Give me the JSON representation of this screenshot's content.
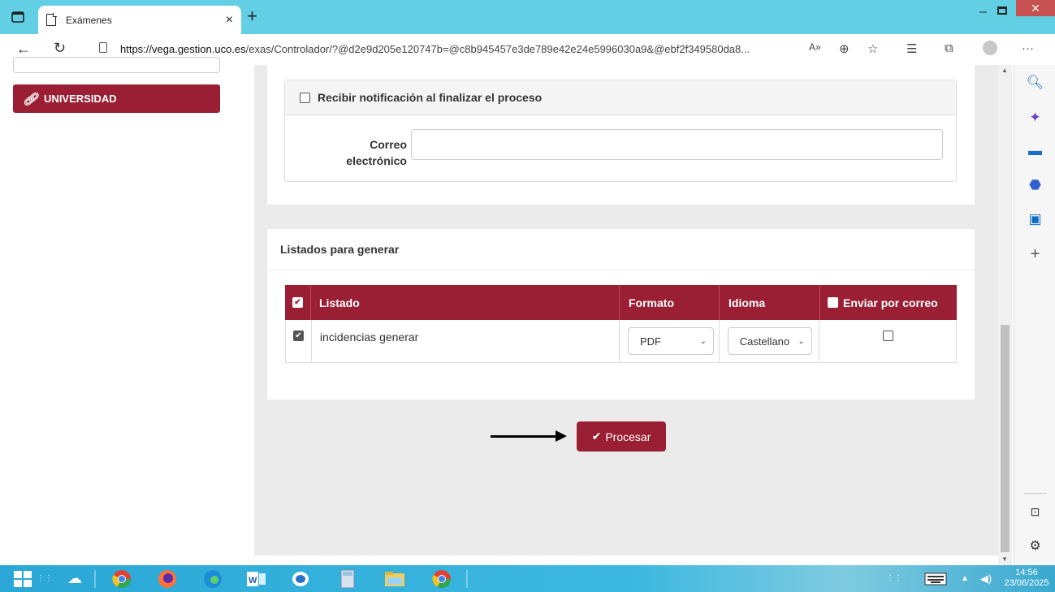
{
  "browser": {
    "tab_title": "Exámenes",
    "tab_close": "×",
    "new_tab": "+",
    "url_host": "https://vega.gestion.uco.es",
    "url_path": "/exas/Controlador/?@d2e9d205e120747b=@c8b945457e3de789e42e24e5996030a9&@ebf2f349580da8...",
    "read_aloud": "A»",
    "minimize": "–",
    "close": "✕",
    "menu": "···"
  },
  "sidebar": {
    "university_label": "UNIVERSIDAD"
  },
  "notification": {
    "checkbox_label": "Recibir notificación al finalizar el proceso",
    "email_label": "Correo electrónico",
    "email_value": ""
  },
  "listados": {
    "heading": "Listados para generar",
    "columns": [
      "Listado",
      "Formato",
      "Idioma",
      "Enviar por correo"
    ],
    "rows": [
      {
        "checked": true,
        "listado": "incidencias generar",
        "formato": "PDF",
        "idioma": "Castellano",
        "enviar": false
      }
    ]
  },
  "actions": {
    "process_label": "Procesar"
  },
  "taskbar": {
    "time": "14:56",
    "date": "23/06/2025"
  },
  "colors": {
    "brand": "#9b1f34",
    "titlebar": "#63cfe5"
  }
}
